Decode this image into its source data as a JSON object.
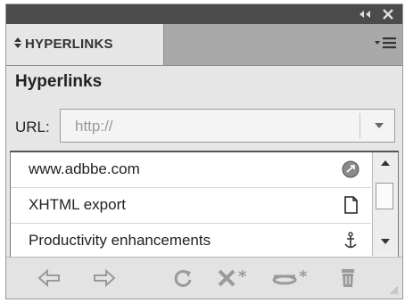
{
  "titlebar": {
    "collapse_glyph": "◂◂",
    "close_glyph": "✕"
  },
  "tab": {
    "icon": "double-arrow-icon",
    "label": "HYPERLINKS"
  },
  "panel_menu": {
    "icon": "panel-menu-icon",
    "glyph": "▾≡"
  },
  "header": {
    "title": "Hyperlinks"
  },
  "url": {
    "label": "URL:",
    "value": "http://"
  },
  "list": {
    "items": [
      {
        "label": "www.adbbe.com",
        "icon": "url-globe-icon"
      },
      {
        "label": "XHTML export",
        "icon": "page-icon"
      },
      {
        "label": "Productivity enhancements",
        "icon": "anchor-icon"
      }
    ]
  },
  "toolbar": {
    "buttons": [
      {
        "name": "go-to-source-button",
        "icon": "arrow-left-icon"
      },
      {
        "name": "go-to-destination-button",
        "icon": "arrow-right-icon"
      },
      {
        "name": "update-hyperlinks-button",
        "icon": "refresh-icon"
      },
      {
        "name": "create-hyperlink-button",
        "icon": "new-hyperlink-icon"
      },
      {
        "name": "create-cross-reference-button",
        "icon": "new-cross-reference-icon"
      },
      {
        "name": "delete-button",
        "icon": "trash-icon"
      }
    ]
  },
  "colors": {
    "titlebar": "#4b4b4b",
    "panel": "#e6e6e6",
    "tabrow": "#a9a9a9",
    "icon_disabled": "#9a9a9a"
  }
}
